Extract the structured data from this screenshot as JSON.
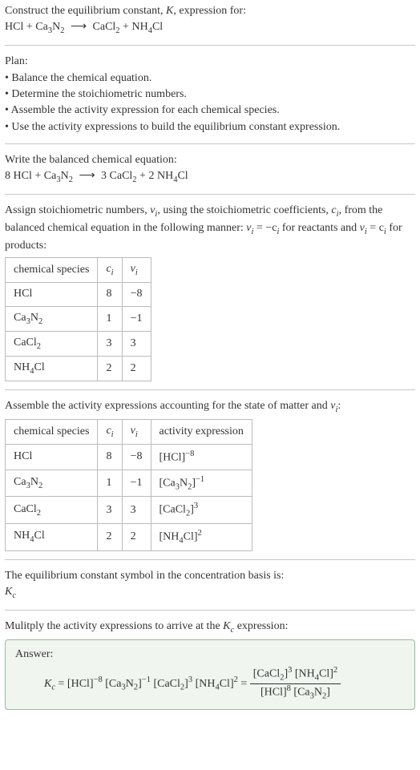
{
  "intro": {
    "line1_pre": "Construct the equilibrium constant, ",
    "Ksym": "K",
    "line1_post": ", expression for:",
    "eq_lhs_a": "HCl",
    "plus": " + ",
    "eq_lhs_b_ca": "Ca",
    "eq_lhs_b_3": "3",
    "eq_lhs_b_n": "N",
    "eq_lhs_b_2": "2",
    "arrow": "⟶",
    "eq_rhs_a_ca": "CaCl",
    "eq_rhs_a_2": "2",
    "eq_rhs_b_nh": "NH",
    "eq_rhs_b_4": "4",
    "eq_rhs_b_cl": "Cl"
  },
  "plan": {
    "title": "Plan:",
    "b1": "• Balance the chemical equation.",
    "b2": "• Determine the stoichiometric numbers.",
    "b3": "• Assemble the activity expression for each chemical species.",
    "b4": "• Use the activity expressions to build the equilibrium constant expression."
  },
  "balanced": {
    "title": "Write the balanced chemical equation:",
    "c_hcl": "8 HCl",
    "c_ca": "Ca",
    "c_3": "3",
    "c_n": "N",
    "c_2": "2",
    "r1_n": "3 CaCl",
    "r1_2": "2",
    "r2_n": "2 NH",
    "r2_4": "4",
    "r2_cl": "Cl"
  },
  "stoich": {
    "intro_a": "Assign stoichiometric numbers, ",
    "nu": "ν",
    "nu_i": "i",
    "intro_b": ", using the stoichiometric coefficients, ",
    "c": "c",
    "c_i": "i",
    "intro_c": ", from the balanced chemical equation in the following manner: ",
    "rel1_pre": "ν",
    "rel1_i": "i",
    "rel1_eq": " = −c",
    "rel1_i2": "i",
    "intro_d": " for reactants and ",
    "rel2_pre": "ν",
    "rel2_i": "i",
    "rel2_eq": " = c",
    "rel2_i2": "i",
    "intro_e": " for products:",
    "th_species": "chemical species",
    "th_ci_c": "c",
    "th_ci_i": "i",
    "th_nu_v": "ν",
    "th_nu_i": "i",
    "rows": [
      {
        "s_a": "HCl",
        "s_b": "",
        "s_c": "",
        "s_d": "",
        "s_e": "",
        "ci": "8",
        "nu": "−8"
      },
      {
        "s_a": "Ca",
        "s_b": "3",
        "s_c": "N",
        "s_d": "2",
        "s_e": "",
        "ci": "1",
        "nu": "−1"
      },
      {
        "s_a": "CaCl",
        "s_b": "2",
        "s_c": "",
        "s_d": "",
        "s_e": "",
        "ci": "3",
        "nu": "3"
      },
      {
        "s_a": "NH",
        "s_b": "4",
        "s_c": "Cl",
        "s_d": "",
        "s_e": "",
        "ci": "2",
        "nu": "2"
      }
    ]
  },
  "activity": {
    "intro_a": "Assemble the activity expressions accounting for the state of matter and ",
    "nu": "ν",
    "nu_i": "i",
    "colon": ":",
    "th_species": "chemical species",
    "th_ci_c": "c",
    "th_ci_i": "i",
    "th_nu_v": "ν",
    "th_nu_i": "i",
    "th_act": "activity expression",
    "rows": [
      {
        "s_a": "HCl",
        "s_b": "",
        "s_c": "",
        "s_d": "",
        "ci": "8",
        "nu": "−8",
        "ae_a": "[HCl]",
        "ae_exp": "−8",
        "ae_b": "",
        "ae_b2": "",
        "ae_c": "",
        "ae_d": ""
      },
      {
        "s_a": "Ca",
        "s_b": "3",
        "s_c": "N",
        "s_d": "2",
        "ci": "1",
        "nu": "−1",
        "ae_a": "[Ca",
        "ae_b": "3",
        "ae_b2": "N",
        "ae_c": "2",
        "ae_d": "]",
        "ae_exp": "−1"
      },
      {
        "s_a": "CaCl",
        "s_b": "2",
        "s_c": "",
        "s_d": "",
        "ci": "3",
        "nu": "3",
        "ae_a": "[CaCl",
        "ae_b": "2",
        "ae_b2": "",
        "ae_c": "",
        "ae_d": "]",
        "ae_exp": "3"
      },
      {
        "s_a": "NH",
        "s_b": "4",
        "s_c": "Cl",
        "s_d": "",
        "ci": "2",
        "nu": "2",
        "ae_a": "[NH",
        "ae_b": "4",
        "ae_b2": "",
        "ae_c": "",
        "ae_d": "Cl]",
        "ae_exp": "2"
      }
    ]
  },
  "basis": {
    "line1": "The equilibrium constant symbol in the concentration basis is:",
    "K": "K",
    "c": "c"
  },
  "mult": {
    "line_a": "Mulitply the activity expressions to arrive at the ",
    "K": "K",
    "c": "c",
    "line_b": " expression:"
  },
  "answer": {
    "label": "Answer:",
    "K": "K",
    "Kc": "c",
    "eq": " = ",
    "t1_a": "[HCl]",
    "t1_exp": "−8",
    "t2_a": "[Ca",
    "t2_b": "3",
    "t2_c": "N",
    "t2_d": "2",
    "t2_e": "]",
    "t2_exp": "−1",
    "t3_a": "[CaCl",
    "t3_b": "2",
    "t3_c": "]",
    "t3_exp": "3",
    "t4_a": "[NH",
    "t4_b": "4",
    "t4_c": "Cl]",
    "t4_exp": "2",
    "eq2": " = ",
    "num_a": "[CaCl",
    "num_b": "2",
    "num_c": "]",
    "num_exp1": "3",
    "num_d": " [NH",
    "num_e": "4",
    "num_f": "Cl]",
    "num_exp2": "2",
    "den_a": "[HCl]",
    "den_exp1": "8",
    "den_b": " [Ca",
    "den_c": "3",
    "den_d": "N",
    "den_e": "2",
    "den_f": "]"
  }
}
